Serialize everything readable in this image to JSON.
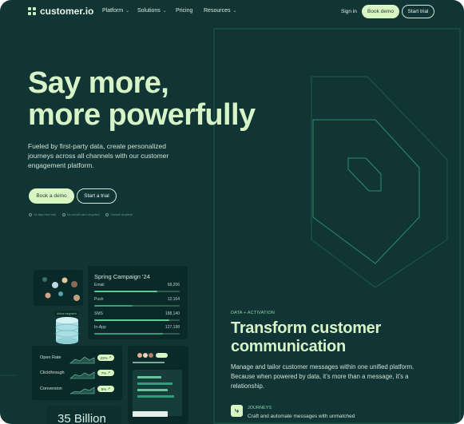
{
  "nav": {
    "brand": "customer.io",
    "items": [
      {
        "label": "Platform",
        "has_menu": true
      },
      {
        "label": "Solutions",
        "has_menu": true
      },
      {
        "label": "Pricing",
        "has_menu": false
      },
      {
        "label": "Resources",
        "has_menu": true
      }
    ],
    "signin": "Sign in",
    "book_demo": "Book demo",
    "start_trial": "Start trial"
  },
  "hero": {
    "title_line1": "Say more,",
    "title_line2": "more powerfully",
    "subtitle": "Fueled by first-party data, create personalized journeys across all channels with our customer engagement platform.",
    "book_demo": "Book a demo",
    "start_trial": "Start a trial",
    "checks": [
      "14-day free trial",
      "No credit card required",
      "Cancel anytime"
    ]
  },
  "dashboard": {
    "campaign_title": "Spring Campaign '24",
    "channels": [
      {
        "label": "Email",
        "value": "68,206",
        "fill": 0.74,
        "color": "#5fc79a"
      },
      {
        "label": "Push",
        "value": "12,164",
        "fill": 0.45,
        "color": "#2f9e7d"
      },
      {
        "label": "SMS",
        "value": "188,140",
        "fill": 0.88,
        "color": "#5fc79a"
      },
      {
        "label": "In-App",
        "value": "127,198",
        "fill": 0.8,
        "color": "#2f9e7d"
      }
    ],
    "segment_badge": "Active segment",
    "metrics": [
      {
        "label": "Open Rate",
        "value": "22%"
      },
      {
        "label": "Clickthrough",
        "value": "7%"
      },
      {
        "label": "Conversion",
        "value": "5%"
      }
    ],
    "big_number": "35 Billion"
  },
  "section": {
    "tag": "DATA + ACTIVATION",
    "title_line1": "Transform customer",
    "title_line2": "communication",
    "description": "Manage and tailor customer messages within one unified platform. Because when powered by data, it’s more than a message, it’s a relationship.",
    "journeys_tag": "JOURNEYS",
    "journeys_desc": "Craft and automate messages with unmatched"
  },
  "colors": {
    "background": "#103534",
    "accent": "#d9f7c3",
    "headline": "#d7f4c9",
    "tag": "#8dd3a9"
  }
}
